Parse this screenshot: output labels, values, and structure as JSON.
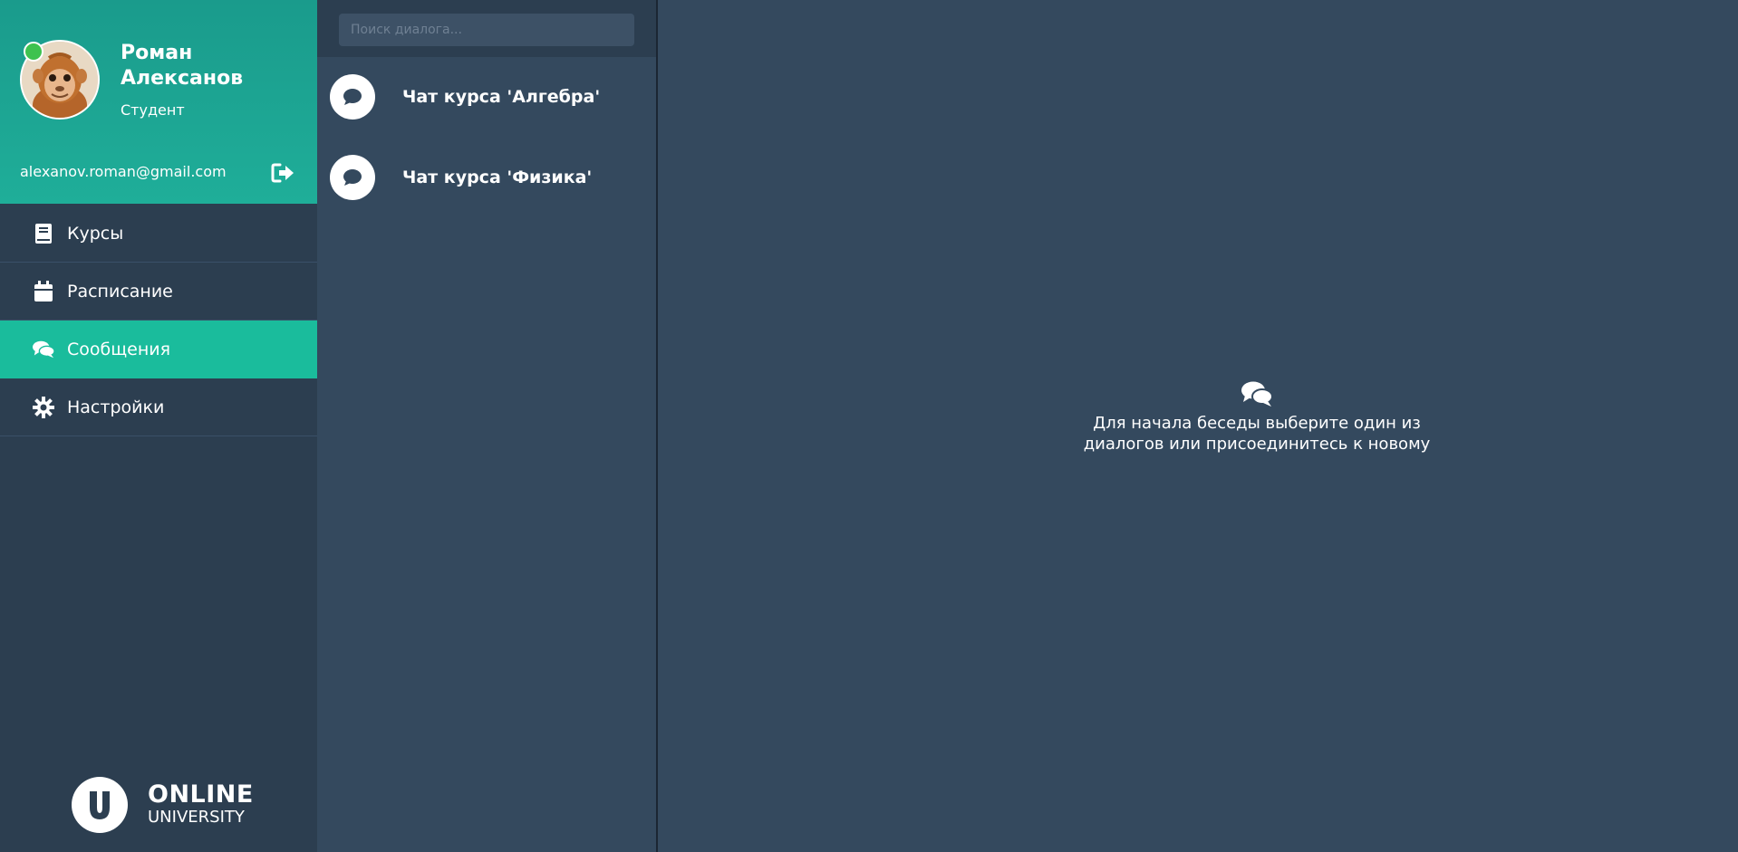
{
  "user": {
    "name": "Роман Алексанов",
    "role": "Студент",
    "email": "alexanov.roman@gmail.com",
    "status_color": "#3ec24f"
  },
  "nav": {
    "items": [
      {
        "label": "Курсы",
        "icon": "book-icon"
      },
      {
        "label": "Расписание",
        "icon": "calendar-icon"
      },
      {
        "label": "Сообщения",
        "icon": "comments-icon",
        "active": true
      },
      {
        "label": "Настройки",
        "icon": "gear-icon"
      }
    ]
  },
  "brand": {
    "logo_letter": "U",
    "line1": "ONLINE",
    "line2": "UNIVERSITY"
  },
  "dialogs": {
    "search_placeholder": "Поиск диалога...",
    "items": [
      {
        "title": "Чат курса 'Алгебра'",
        "icon": "chat-bubble-icon"
      },
      {
        "title": "Чат курса 'Физика'",
        "icon": "chat-bubble-icon"
      }
    ]
  },
  "main": {
    "empty_message": "Для начала беседы выберите один из диалогов или присоединитесь к новому",
    "empty_icon": "comments-icon"
  },
  "colors": {
    "accent": "#1abc9c",
    "sidebar": "#2c3e50",
    "content": "#34495e"
  }
}
